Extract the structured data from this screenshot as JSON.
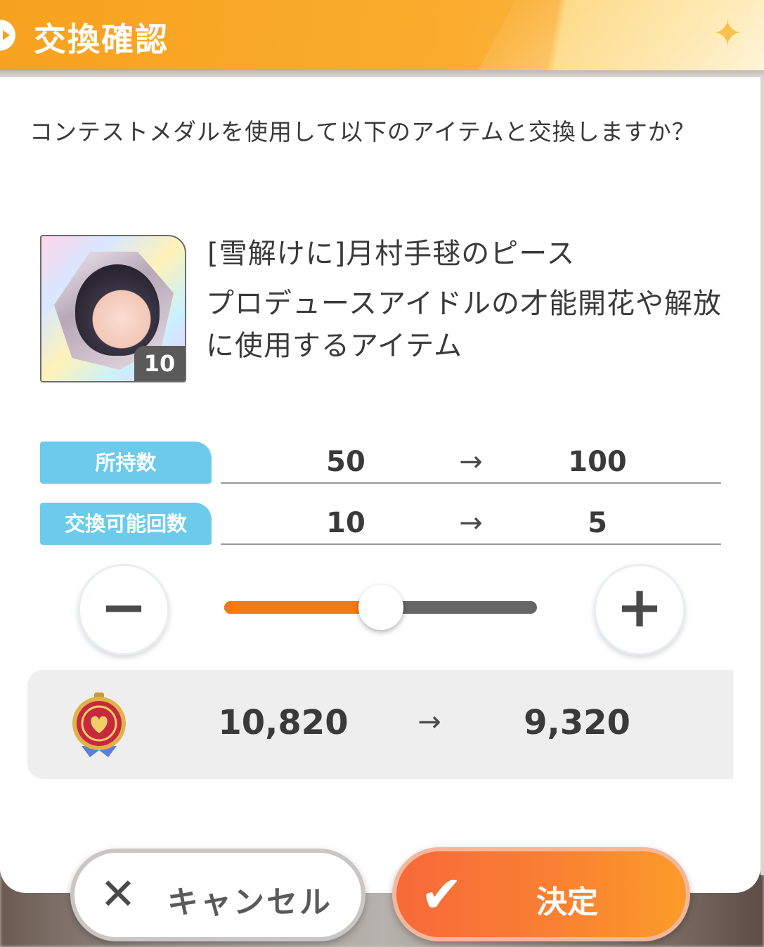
{
  "header": {
    "title": "交換確認"
  },
  "dialog": {
    "question": "コンテストメダルを使用して以下のアイテムと交換しますか？",
    "item": {
      "name": "[雪解けに]月村手毬のピース",
      "description": "プロデュースアイドルの才能開花や解放に使用するアイテム",
      "quantity_badge": "10"
    },
    "stats": [
      {
        "label": "所持数",
        "from": "50",
        "to": "100"
      },
      {
        "label": "交換可能回数",
        "from": "10",
        "to": "5"
      }
    ],
    "slider": {
      "fraction": 0.5
    },
    "currency": {
      "icon": "contest-medal-icon",
      "from": "10,820",
      "to": "9,320"
    }
  },
  "buttons": {
    "cancel": "キャンセル",
    "confirm": "決定"
  },
  "icons": {
    "minus": "−",
    "plus": "+",
    "arrow": "→",
    "close": "✕",
    "check": "✔"
  },
  "colors": {
    "accent": "#f7a21f",
    "label_bg": "#6ccbeb",
    "slider_fill": "#f57a12",
    "confirm": "#f97e33"
  }
}
